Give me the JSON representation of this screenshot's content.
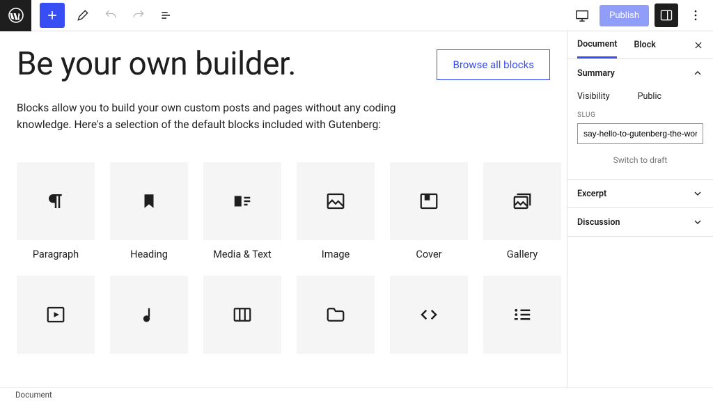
{
  "topbar": {
    "publish_label": "Publish"
  },
  "content": {
    "title": "Be your own builder.",
    "browse_label": "Browse all blocks",
    "description": "Blocks allow you to build your own custom posts and pages without any coding knowledge. Here's a selection of the default blocks included with Gutenberg:"
  },
  "blocks_row1": [
    {
      "label": "Paragraph"
    },
    {
      "label": "Heading"
    },
    {
      "label": "Media & Text"
    },
    {
      "label": "Image"
    },
    {
      "label": "Cover"
    },
    {
      "label": "Gallery"
    }
  ],
  "blocks_row2": [
    {
      "label": ""
    },
    {
      "label": ""
    },
    {
      "label": ""
    },
    {
      "label": ""
    },
    {
      "label": ""
    },
    {
      "label": ""
    }
  ],
  "sidebar": {
    "tab_document": "Document",
    "tab_block": "Block",
    "summary_title": "Summary",
    "visibility_label": "Visibility",
    "visibility_value": "Public",
    "slug_label": "SLUG",
    "slug_value": "say-hello-to-gutenberg-the-wordpress-ed",
    "switch_draft": "Switch to draft",
    "excerpt_title": "Excerpt",
    "discussion_title": "Discussion"
  },
  "footer": {
    "breadcrumb": "Document"
  }
}
